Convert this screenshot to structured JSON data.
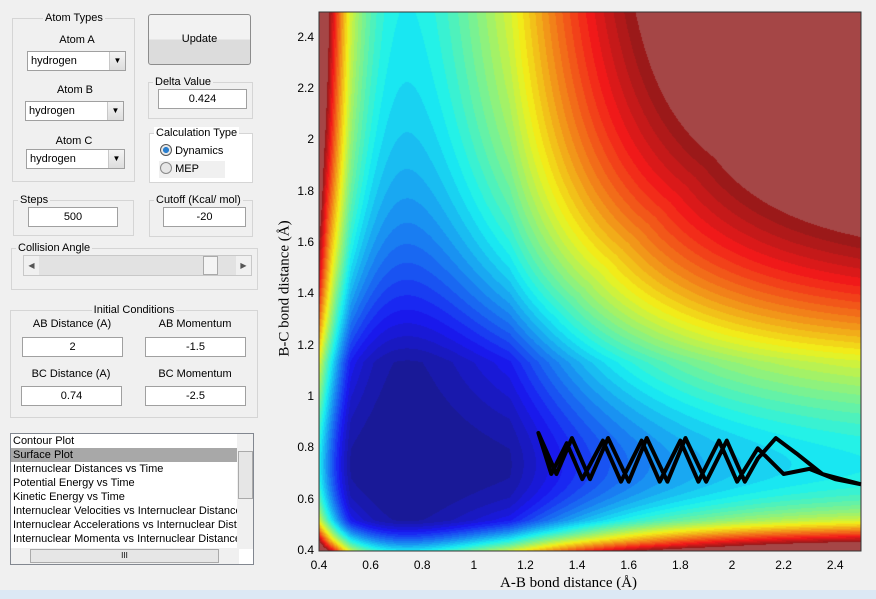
{
  "atom_types": {
    "title": "Atom Types",
    "atom_a_label": "Atom A",
    "atom_a": "hydrogen",
    "atom_b_label": "Atom B",
    "atom_b": "hydrogen",
    "atom_c_label": "Atom C",
    "atom_c": "hydrogen"
  },
  "update_label": "Update",
  "delta": {
    "title": "Delta Value",
    "value": "0.424"
  },
  "calc": {
    "title": "Calculation Type",
    "options": [
      "Dynamics",
      "MEP"
    ],
    "selected": "Dynamics"
  },
  "steps": {
    "title": "Steps",
    "value": "500"
  },
  "cutoff": {
    "title": "Cutoff (Kcal/ mol)",
    "value": "-20"
  },
  "collision": {
    "title": "Collision Angle",
    "slider_fraction": 0.9
  },
  "initial": {
    "title": "Initial Conditions",
    "ab_dist_label": "AB Distance (A)",
    "ab_dist": "2",
    "ab_mom_label": "AB Momentum",
    "ab_mom": "-1.5",
    "bc_dist_label": "BC Distance (A)",
    "bc_dist": "0.74",
    "bc_mom_label": "BC Momentum",
    "bc_mom": "-2.5"
  },
  "plot_list": {
    "items": [
      "Contour Plot",
      "Surface Plot",
      "Internuclear Distances vs Time",
      "Potential Energy vs Time",
      "Kinetic Energy vs Time",
      "Internuclear Velocities vs Internuclear Distance",
      "Internuclear Accelerations vs Internuclear Distance",
      "Internuclear Momenta vs Internuclear Distance"
    ],
    "selected_index": 1
  },
  "chart_data": {
    "type": "heatmap",
    "xlabel": "A-B bond distance (Å)",
    "ylabel": "B-C bond distance (Å)",
    "xlim": [
      0.4,
      2.5
    ],
    "ylim": [
      0.4,
      2.5
    ],
    "xticks": [
      "0.4",
      "0.6",
      "0.8",
      "1",
      "1.2",
      "1.4",
      "1.6",
      "1.8",
      "2",
      "2.2",
      "2.4"
    ],
    "yticks": [
      "0.4",
      "0.6",
      "0.8",
      "1",
      "1.2",
      "1.4",
      "1.6",
      "1.8",
      "2",
      "2.2",
      "2.4"
    ],
    "colormap": "jet",
    "grid": false,
    "trajectory": [
      [
        2.5,
        0.66
      ],
      [
        2.35,
        0.7
      ],
      [
        2.25,
        0.78
      ],
      [
        2.17,
        0.84
      ],
      [
        2.1,
        0.76
      ],
      [
        2.05,
        0.67
      ],
      [
        1.98,
        0.83
      ],
      [
        1.9,
        0.67
      ],
      [
        1.82,
        0.84
      ],
      [
        1.75,
        0.67
      ],
      [
        1.67,
        0.84
      ],
      [
        1.6,
        0.67
      ],
      [
        1.52,
        0.84
      ],
      [
        1.45,
        0.68
      ],
      [
        1.38,
        0.84
      ],
      [
        1.32,
        0.7
      ],
      [
        1.25,
        0.86
      ],
      [
        1.3,
        0.7
      ],
      [
        1.36,
        0.82
      ],
      [
        1.42,
        0.68
      ],
      [
        1.5,
        0.83
      ],
      [
        1.57,
        0.67
      ],
      [
        1.65,
        0.83
      ],
      [
        1.72,
        0.67
      ],
      [
        1.8,
        0.83
      ],
      [
        1.87,
        0.67
      ],
      [
        1.95,
        0.83
      ],
      [
        2.02,
        0.67
      ],
      [
        2.1,
        0.8
      ],
      [
        2.2,
        0.7
      ],
      [
        2.3,
        0.72
      ],
      [
        2.4,
        0.68
      ],
      [
        2.5,
        0.66
      ]
    ]
  }
}
